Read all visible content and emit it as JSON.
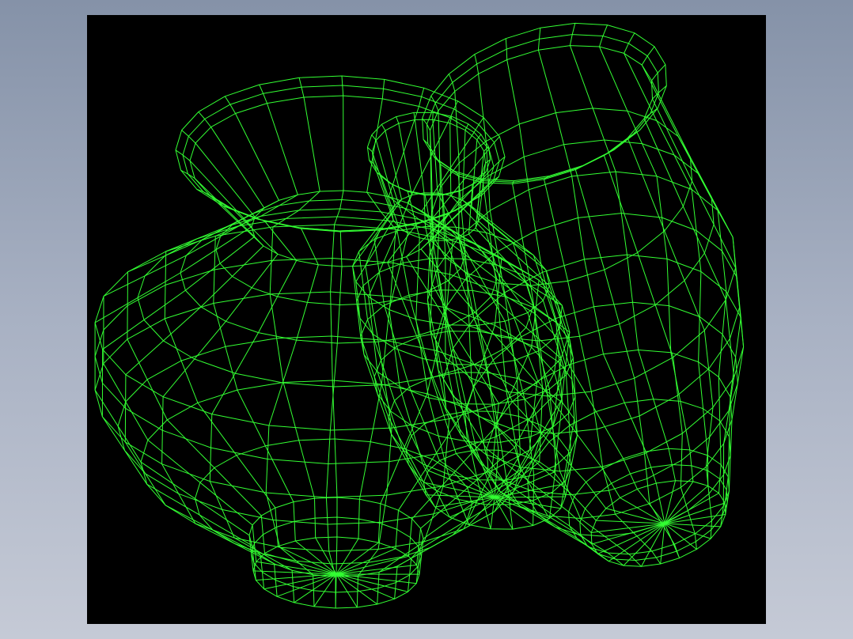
{
  "viewport": {
    "background_color": "#000000",
    "wire_color": "#33ff33",
    "render_mode": "wireframe"
  },
  "scene": {
    "objects": [
      {
        "name": "vase-front-left"
      },
      {
        "name": "vase-middle"
      },
      {
        "name": "vase-back-right"
      }
    ]
  }
}
